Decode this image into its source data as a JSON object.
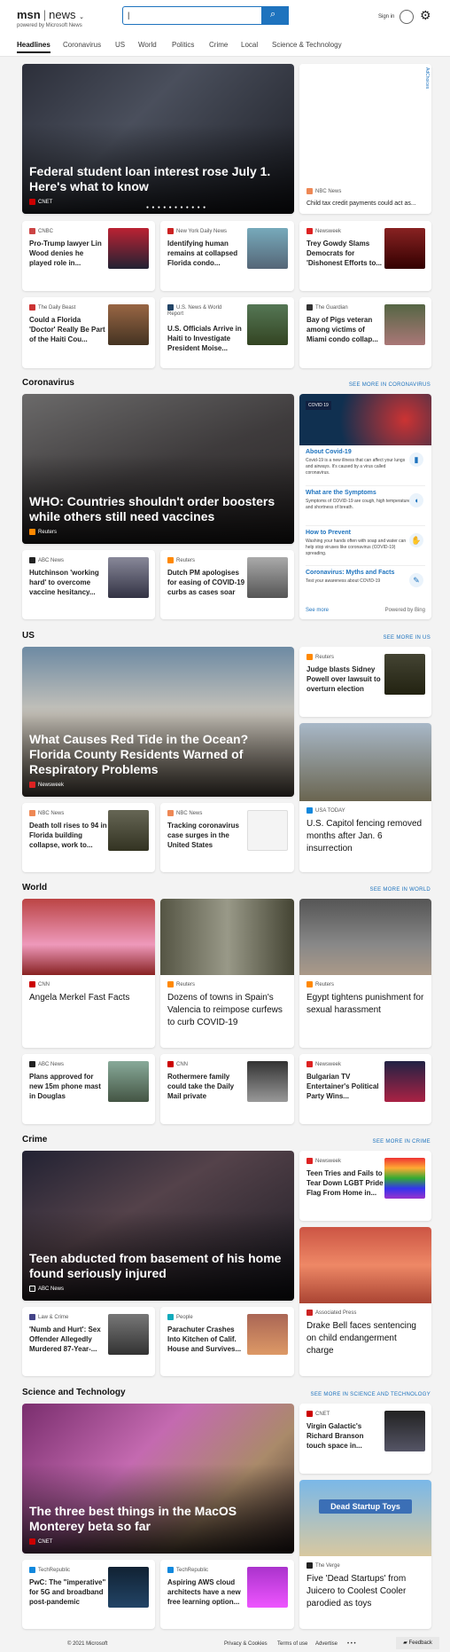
{
  "header": {
    "brand": "msn",
    "brand_section": "news",
    "tagline": "powered by Microsoft News",
    "search_value": "|",
    "signin": "Sign in"
  },
  "nav": [
    "Headlines",
    "Coronavirus",
    "US",
    "World",
    "Politics",
    "Crime",
    "Local",
    "Science & Technology"
  ],
  "headlines": {
    "hero": {
      "title": "Federal student loan interest rose July 1. Here's what to know",
      "source": "CNET"
    },
    "ad": {
      "source": "NBC News",
      "title": "Child tax credit payments could act as...",
      "label": "AdChoices"
    },
    "cards": [
      {
        "source": "CNBC",
        "title": "Pro-Trump lawyer Lin Wood denies he played role in..."
      },
      {
        "source": "New York Daily News",
        "title": "Identifying human remains at collapsed Florida condo..."
      },
      {
        "source": "Newsweek",
        "title": "Trey Gowdy Slams Democrats for 'Dishonest Efforts to..."
      },
      {
        "source": "The Daily Beast",
        "title": "Could a Florida 'Doctor' Really Be Part of the Haiti Cou..."
      },
      {
        "source": "U.S. News & World Report",
        "title": "U.S. Officials Arrive in Haiti to Investigate President Moise..."
      },
      {
        "source": "The Guardian",
        "title": "Bay of Pigs veteran among victims of Miami condo collap..."
      }
    ]
  },
  "coronavirus": {
    "heading": "Coronavirus",
    "more": "SEE MORE IN CORONAVIRUS",
    "hero": {
      "title": "WHO: Countries shouldn't order boosters while others still need vaccines",
      "source": "Reuters"
    },
    "cards": [
      {
        "source": "ABC News",
        "title": "Hutchinson 'working hard' to overcome vaccine hesitancy..."
      },
      {
        "source": "Reuters",
        "title": "Dutch PM apologises for easing of COVID-19 curbs as cases soar"
      }
    ],
    "panel": {
      "badge": "COVID 19",
      "items": [
        {
          "title": "About Covid-19",
          "desc": "Covid-19 is a new illness that can affect your lungs and airways. It's caused by a virus called coronavirus."
        },
        {
          "title": "What are the Symptoms",
          "desc": "Symptoms of COVID-19 are cough, high temperature and shortness of breath."
        },
        {
          "title": "How to Prevent",
          "desc": "Washing your hands often with soap and water can help stop viruses like coronavirus (COVID-19) spreading."
        },
        {
          "title": "Coronavirus: Myths and Facts",
          "desc": "Test your awareness about COVID-19"
        }
      ],
      "see_more": "See more",
      "powered": "Powered by Bing"
    }
  },
  "us": {
    "heading": "US",
    "more": "SEE MORE IN US",
    "hero": {
      "title": "What Causes Red Tide in the Ocean? Florida County Residents Warned of Respiratory Problems",
      "source": "Newsweek"
    },
    "side": {
      "source": "Reuters",
      "title": "Judge blasts Sidney Powell over lawsuit to overturn election"
    },
    "big": {
      "source": "USA TODAY",
      "title": "U.S. Capitol fencing removed months after Jan. 6 insurrection"
    },
    "cards": [
      {
        "source": "NBC News",
        "title": "Death toll rises to 94 in Florida building collapse, work to..."
      },
      {
        "source": "NBC News",
        "title": "Tracking coronavirus case surges in the United States"
      }
    ]
  },
  "world": {
    "heading": "World",
    "more": "SEE MORE IN WORLD",
    "big": [
      {
        "source": "CNN",
        "title": "Angela Merkel Fast Facts"
      },
      {
        "source": "Reuters",
        "title": "Dozens of towns in Spain's Valencia to reimpose curfews to curb COVID-19"
      },
      {
        "source": "Reuters",
        "title": "Egypt tightens punishment for sexual harassment"
      }
    ],
    "cards": [
      {
        "source": "ABC News",
        "title": "Plans approved for new 15m phone mast in Douglas"
      },
      {
        "source": "CNN",
        "title": "Rothermere family could take the Daily Mail private"
      },
      {
        "source": "Newsweek",
        "title": "Bulgarian TV Entertainer's Political Party Wins..."
      }
    ]
  },
  "crime": {
    "heading": "Crime",
    "more": "SEE MORE IN CRIME",
    "hero": {
      "title": "Teen abducted from basement of his home found seriously injured",
      "source": "ABC News"
    },
    "side": {
      "source": "Newsweek",
      "title": "Teen Tries and Fails to Tear Down LGBT Pride Flag From Home in..."
    },
    "big": {
      "source": "Associated Press",
      "title": "Drake Bell faces sentencing on child endangerment charge"
    },
    "cards": [
      {
        "source": "Law & Crime",
        "title": "'Numb and Hurt': Sex Offender Allegedly Murdered 87-Year-..."
      },
      {
        "source": "People",
        "title": "Parachuter Crashes Into Kitchen of Calif. House and Survives..."
      }
    ]
  },
  "scitech": {
    "heading": "Science and Technology",
    "more": "SEE MORE IN SCIENCE AND TECHNOLOGY",
    "hero": {
      "title": "The three best things in the MacOS Monterey beta so far",
      "source": "CNET"
    },
    "side": {
      "source": "CNET",
      "title": "Virgin Galactic's Richard Branson touch space in..."
    },
    "big": {
      "source": "The Verge",
      "title": "Five 'Dead Startups' from Juicero to Coolest Cooler parodied as toys",
      "image_text": "Dead Startup Toys"
    },
    "cards": [
      {
        "source": "TechRepublic",
        "title": "PwC: The \"imperative\" for 5G and broadband post-pandemic"
      },
      {
        "source": "TechRepublic",
        "title": "Aspiring AWS cloud architects have a new free learning option..."
      }
    ]
  },
  "footer": {
    "copyright": "© 2021 Microsoft",
    "privacy": "Privacy & Cookies",
    "terms": "Terms of use",
    "advertise": "Advertise",
    "more": "• • •",
    "feedback": "Feedback"
  }
}
